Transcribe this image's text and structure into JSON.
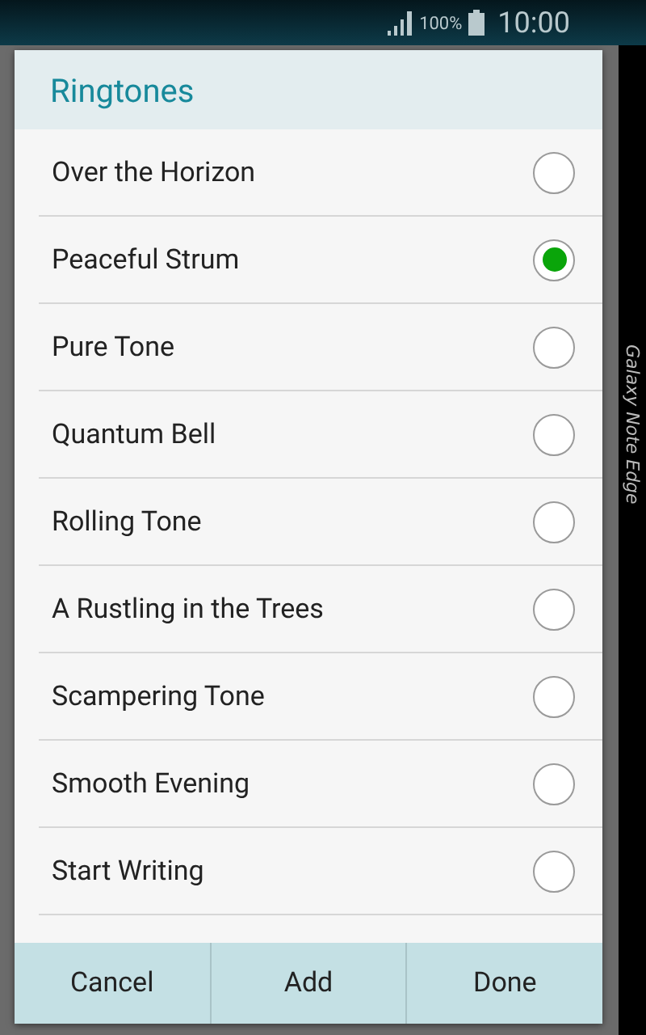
{
  "status_bar": {
    "battery": "100%",
    "time": "10:00"
  },
  "dialog": {
    "title": "Ringtones",
    "items": [
      {
        "label": "Over the Horizon",
        "selected": false
      },
      {
        "label": "Peaceful Strum",
        "selected": true
      },
      {
        "label": "Pure Tone",
        "selected": false
      },
      {
        "label": "Quantum Bell",
        "selected": false
      },
      {
        "label": "Rolling Tone",
        "selected": false
      },
      {
        "label": "A Rustling in the Trees",
        "selected": false
      },
      {
        "label": "Scampering Tone",
        "selected": false
      },
      {
        "label": "Smooth Evening",
        "selected": false
      },
      {
        "label": "Start Writing",
        "selected": false
      }
    ],
    "buttons": [
      "Cancel",
      "Add",
      "Done"
    ]
  },
  "edge_label": "Galaxy Note Edge"
}
